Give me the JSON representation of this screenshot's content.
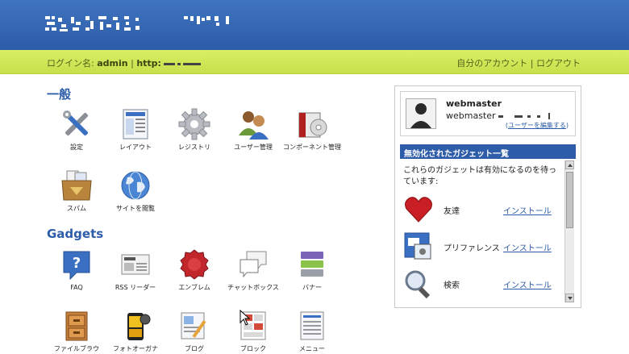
{
  "header": {
    "title_note": ""
  },
  "loginbar": {
    "login_label": "ログイン名:",
    "username": "admin",
    "separator": "|",
    "url_prefix": "http:",
    "my_account": "自分のアカウント",
    "logout": "ログアウト",
    "right_separator": "|"
  },
  "general": {
    "title": "一般",
    "items": [
      {
        "label": "設定",
        "icon": "tools-icon"
      },
      {
        "label": "レイアウト",
        "icon": "layout-icon"
      },
      {
        "label": "レジストリ",
        "icon": "gear-icon"
      },
      {
        "label": "ユーザー管理",
        "icon": "users-icon"
      },
      {
        "label": "コンポーネント管理",
        "icon": "component-icon"
      },
      {
        "label": "スパム",
        "icon": "spam-box-icon"
      },
      {
        "label": "サイトを閲覧",
        "icon": "globe-icon"
      }
    ]
  },
  "gadgets": {
    "title": "Gadgets",
    "items": [
      {
        "label": "FAQ",
        "icon": "faq-icon"
      },
      {
        "label": "RSS リーダー",
        "icon": "news-icon"
      },
      {
        "label": "エンブレム",
        "icon": "emblem-icon"
      },
      {
        "label": "チャットボックス",
        "icon": "chat-icon"
      },
      {
        "label": "バナー",
        "icon": "banner-icon"
      },
      {
        "label": "ファイルブラウ",
        "icon": "cabinet-icon"
      },
      {
        "label": "フォトオーガナ",
        "icon": "film-icon"
      },
      {
        "label": "ブログ",
        "icon": "blog-icon"
      },
      {
        "label": "ブロック",
        "icon": "block-icon"
      },
      {
        "label": "メニュー",
        "icon": "menu-icon"
      }
    ]
  },
  "user_panel": {
    "name": "webmaster",
    "email_prefix": "webmaster",
    "edit_open": "(",
    "edit_link": "ユーザーを編集する",
    "edit_close": ")"
  },
  "disabled_gadgets": {
    "title": "無効化されたガジェット一覧",
    "description": "これらのガジェットは有効になるのを待っています:",
    "install_label": "インストール",
    "items": [
      {
        "name": "友達",
        "icon": "heart-icon"
      },
      {
        "name": "プリファレンス",
        "icon": "preferences-icon"
      },
      {
        "name": "検索",
        "icon": "magnifier-icon"
      }
    ]
  },
  "colors": {
    "header_blue": "#2d5ca8",
    "login_bar_green": "#c6e04a",
    "link_blue": "#2d5ca8"
  }
}
